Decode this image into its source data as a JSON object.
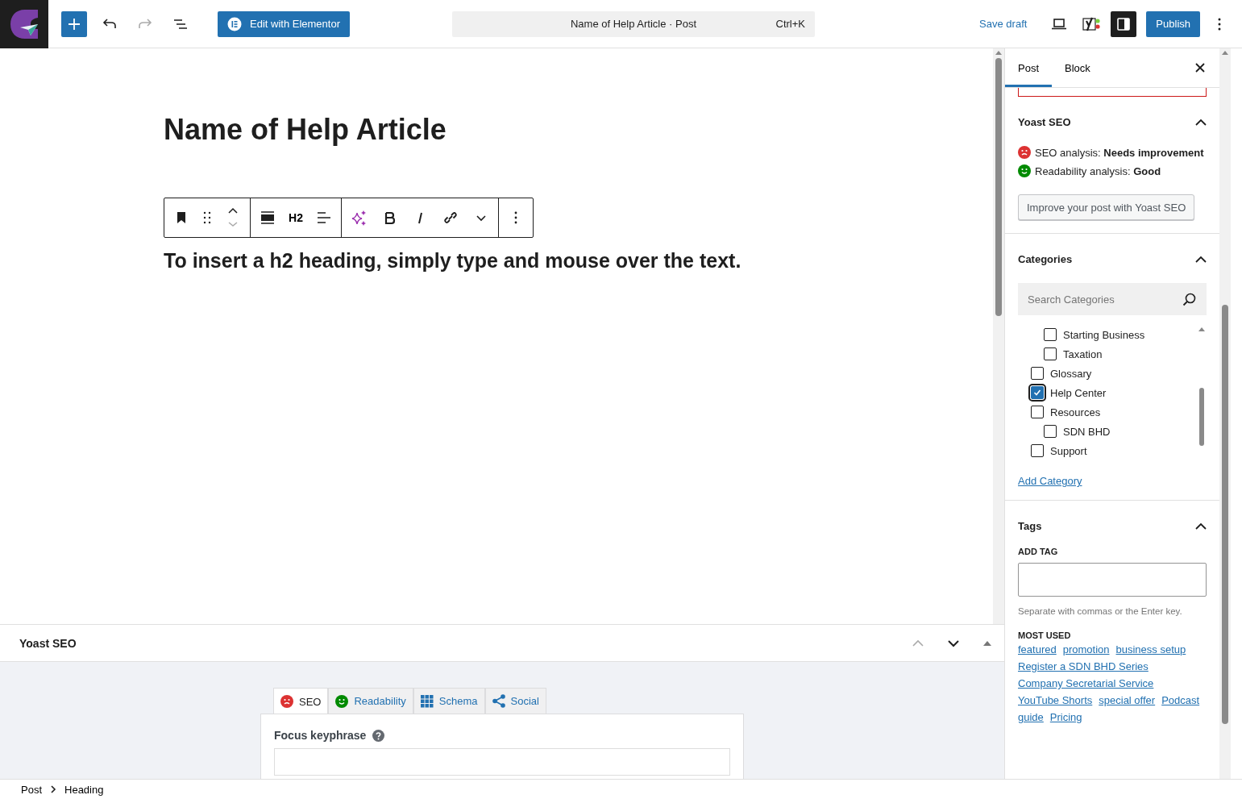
{
  "topbar": {
    "edit_button": "Edit with Elementor",
    "command": {
      "title": "Name of Help Article · Post",
      "shortcut": "Ctrl+K"
    },
    "save_draft": "Save draft",
    "settings_on": true,
    "publish": "Publish"
  },
  "editor": {
    "title": "Name of Help Article",
    "block_toolbar": {
      "heading_level": "H2"
    },
    "heading": "To insert a h2 heading, simply type and mouse over the text."
  },
  "metabox": {
    "title": "Yoast SEO",
    "tabs": [
      {
        "label": "SEO",
        "kind": "sad",
        "color": "#dc3232",
        "selected": true
      },
      {
        "label": "Readability",
        "kind": "happy",
        "color": "#008a00",
        "selected": false
      },
      {
        "label": "Schema",
        "kind": "schema",
        "selected": false
      },
      {
        "label": "Social",
        "kind": "social",
        "selected": false
      }
    ],
    "focus_label": "Focus keyphrase"
  },
  "sidebar": {
    "tabs": [
      {
        "label": "Post",
        "selected": true
      },
      {
        "label": "Block",
        "selected": false
      }
    ],
    "yoast": {
      "title": "Yoast SEO",
      "expanded": true,
      "analyses": [
        {
          "label": "SEO analysis:",
          "result": "Needs improvement",
          "kind": "sad",
          "color": "#dc3232"
        },
        {
          "label": "Readability analysis:",
          "result": "Good",
          "kind": "happy",
          "color": "#008a00"
        }
      ],
      "button": "Improve your post with Yoast SEO"
    },
    "categories": {
      "title": "Categories",
      "expanded": true,
      "search_placeholder": "Search Categories",
      "items": [
        {
          "children": [
            {
              "label": "Starting Business",
              "checked": false
            },
            {
              "label": "Taxation",
              "checked": false
            }
          ]
        },
        {
          "label": "Glossary",
          "checked": false
        },
        {
          "label": "Help Center",
          "checked": true
        },
        {
          "label": "Resources",
          "checked": false,
          "children": [
            {
              "label": "SDN BHD",
              "checked": false
            }
          ]
        },
        {
          "label": "Support",
          "checked": false
        }
      ],
      "add_link": "Add Category"
    },
    "tags": {
      "title": "Tags",
      "expanded": true,
      "add_label": "ADD TAG",
      "hint": "Separate with commas or the Enter key.",
      "most_used_label": "MOST USED",
      "items": [
        "featured",
        "promotion",
        "business setup",
        "Register a SDN BHD Series",
        "Company Secretarial Service",
        "YouTube Shorts",
        "special offer",
        "Podcast",
        "guide",
        "Pricing"
      ]
    }
  },
  "breadcrumb": [
    "Post",
    "Heading"
  ]
}
